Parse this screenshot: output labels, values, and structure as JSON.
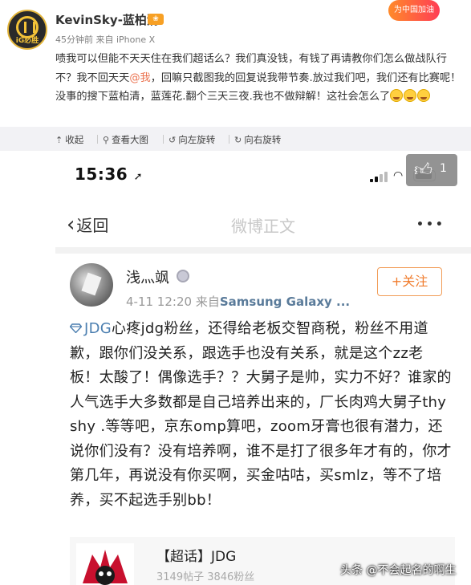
{
  "post": {
    "author": "KevinSky-蓝柏清",
    "avatar_team_text": "iG必胜",
    "event_badge": "为中国加油",
    "time": "45分钟前",
    "source": "来自 iPhone X",
    "text_before_at": "啧我可以但能不天天住在我们超话么？我们真没钱，有钱了再请教你们怎么做战队行不？我不回天天",
    "at_user": "@我",
    "text_after_at": "，回嘛只截图我的回复说我带节奏.放过我们吧，我们还有比赛呢！没事的搜下蓝柏清，蓝莲花.翻个三天三夜.我也不做辩解！这社会怎么了"
  },
  "toolbar": {
    "collapse": "收起",
    "view_large": "查看大图",
    "rotate_left": "向左旋转",
    "rotate_right": "向右旋转",
    "icons": [
      "collapse-icon",
      "search-icon",
      "rotate-left-icon",
      "rotate-right-icon"
    ]
  },
  "screenshot": {
    "status_time": "15:36",
    "location_glyph": "➚",
    "like_count": "1",
    "back_label": "返回",
    "nav_title": "微博正文",
    "more_glyph": "•••",
    "author_name": "浅灬飒",
    "post_time": "4-11 12:20",
    "from_label": "来自",
    "device": "Samsung Galaxy ...",
    "follow_label": "+关注",
    "topic": "JDG",
    "body": "心疼jdg粉丝，还得给老板交智商税，粉丝不用道歉，跟你们没关系，跟选手也没有关系，就是这个zz老板！太酸了！偶像选手？？大舅子是帅，实力不好？谁家的人气选手大多数都是自己培养出来的，厂长肉鸡大舅子thy shy .等等吧，京东omp算吧，zoom牙膏也很有潜力，还说你们没有？没有培养啊，谁不是打了很多年才有的，你才第几年，再说没有你买啊，买金咕咕，买smlz，等不了培养，买不起选手别bb！",
    "card_title": "【超话】JDG",
    "card_subtitle": "3149帖子 3846粉丝"
  },
  "watermark": "头条 @不会起名的啊生",
  "colors": {
    "link": "#eb7350",
    "topic": "#4c7fb0",
    "follow": "#f07c2d",
    "toolbar_bg": "#f2f2f5"
  }
}
